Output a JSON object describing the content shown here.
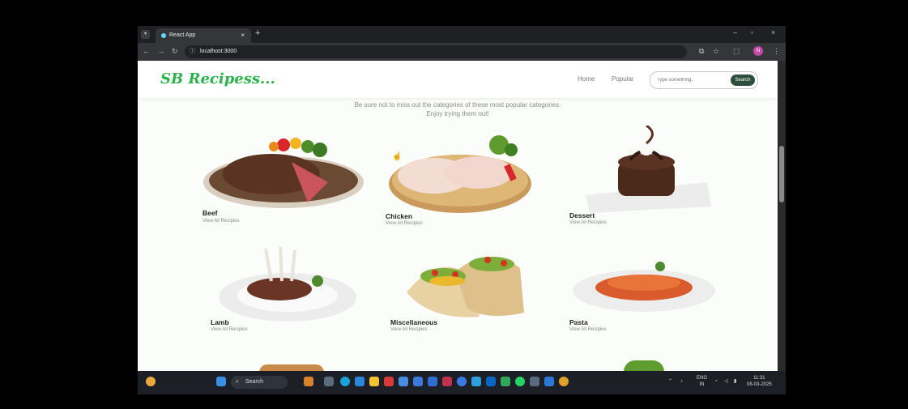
{
  "browser": {
    "tab_title": "React App",
    "tab_close": "×",
    "new_tab": "+",
    "url": "localhost:3000",
    "window_controls": [
      "–",
      "▫",
      "×"
    ],
    "nav": {
      "back": "←",
      "forward": "→",
      "reload": "↻"
    },
    "profile_initial": "N"
  },
  "site": {
    "logo": "SB Recipess...",
    "nav": {
      "home": "Home",
      "popular": "Popular"
    },
    "search": {
      "placeholder": "Type something..",
      "button": "Search"
    },
    "intro_line1": "Be sure not to miss out the categories of these most popular categories.",
    "intro_line2": "Enjoy trying them out!",
    "categories": [
      {
        "name": "Beef",
        "link": "View All Recipies"
      },
      {
        "name": "Chicken",
        "link": "View All Recipies"
      },
      {
        "name": "Dessert",
        "link": "View All Recipies"
      },
      {
        "name": "Lamb",
        "link": "View All Recipies"
      },
      {
        "name": "Miscellaneous",
        "link": "View All Recipies"
      },
      {
        "name": "Pasta",
        "link": "View All Recipies"
      }
    ]
  },
  "taskbar": {
    "search_label": "Search",
    "tray_lang": "ENG",
    "tray_region": "IN",
    "time": "11:31",
    "date": "08-03-2025"
  },
  "colors": {
    "accent": "#2bb24c",
    "search_button": "#2e4f3e"
  }
}
